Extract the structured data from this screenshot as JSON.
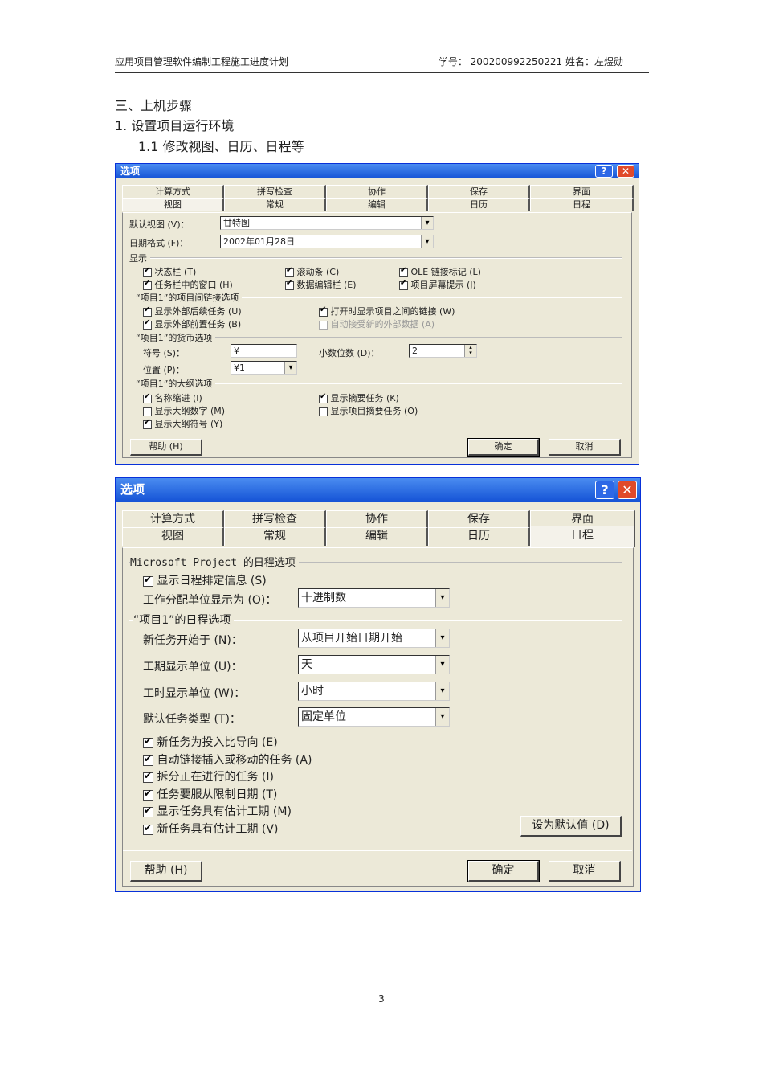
{
  "header": {
    "title": "应用项目管理软件编制工程施工进度计划",
    "student": "学号： 200200992250221    姓名：左煜勋"
  },
  "headings": {
    "h1": "三、上机步骤",
    "h2": "1.  设置项目运行环境",
    "h3": "1.1  修改视图、日历、日程等"
  },
  "dialog1": {
    "title": "选项",
    "help_icon": "question-icon",
    "close_icon": "close-icon",
    "tabs_row1": [
      "计算方式",
      "拼写检查",
      "协作",
      "保存",
      "界面"
    ],
    "tabs_row2": [
      "视图",
      "常规",
      "编辑",
      "日历",
      "日程"
    ],
    "active_tab": "视图",
    "default_view_label": "默认视图 (V)：",
    "default_view_value": "甘特图",
    "date_format_label": "日期格式 (F)：",
    "date_format_value": "2002年01月28日",
    "display_section": "显示",
    "display_checks": [
      {
        "label": "状态栏 (T)",
        "checked": true
      },
      {
        "label": "滚动条 (C)",
        "checked": true
      },
      {
        "label": "OLE 链接标记 (L)",
        "checked": true
      },
      {
        "label": "任务栏中的窗口 (H)",
        "checked": true
      },
      {
        "label": "数据编辑栏 (E)",
        "checked": true
      },
      {
        "label": "项目屏幕提示 (J)",
        "checked": true
      }
    ],
    "cross_section": "“项目1”的项目间链接选项",
    "cross_checks": [
      {
        "label": "显示外部后续任务 (U)",
        "checked": true
      },
      {
        "label": "打开时显示项目之间的链接 (W)",
        "checked": true
      },
      {
        "label": "显示外部前置任务 (B)",
        "checked": true
      },
      {
        "label": "自动接受新的外部数据 (A)",
        "checked": false,
        "disabled": true
      }
    ],
    "currency_section": "“项目1”的货币选项",
    "symbol_label": "符号 (S)：",
    "symbol_value": "¥",
    "decimals_label": "小数位数 (D)：",
    "decimals_value": "2",
    "position_label": "位置 (P)：",
    "position_value": "¥1",
    "outline_section": "“项目1”的大纲选项",
    "outline_checks": [
      {
        "label": "名称缩进 (I)",
        "checked": true
      },
      {
        "label": "显示摘要任务 (K)",
        "checked": true
      },
      {
        "label": "显示大纲数字 (M)",
        "checked": false
      },
      {
        "label": "显示项目摘要任务 (O)",
        "checked": false
      },
      {
        "label": "显示大纲符号 (Y)",
        "checked": true
      }
    ],
    "help_button": "帮助 (H)",
    "ok_button": "确定",
    "cancel_button": "取消"
  },
  "dialog2": {
    "title": "选项",
    "tabs_row1": [
      "计算方式",
      "拼写检查",
      "协作",
      "保存",
      "界面"
    ],
    "tabs_row2": [
      "视图",
      "常规",
      "编辑",
      "日历",
      "日程"
    ],
    "active_tab": "日程",
    "ms_section": "Microsoft Project 的日程选项",
    "show_sched_msgs": {
      "label": "显示日程排定信息 (S)",
      "checked": true
    },
    "assign_units_label": "工作分配单位显示为 (O)：",
    "assign_units_value": "十进制数",
    "proj_section": "“项目1”的日程选项",
    "new_tasks_label": "新任务开始于 (N)：",
    "new_tasks_value": "从项目开始日期开始",
    "duration_label": "工期显示单位 (U)：",
    "duration_value": "天",
    "work_label": "工时显示单位 (W)：",
    "work_value": "小时",
    "task_type_label": "默认任务类型 (T)：",
    "task_type_value": "固定单位",
    "checks": [
      {
        "label": "新任务为投入比导向 (E)",
        "checked": true
      },
      {
        "label": "自动链接插入或移动的任务 (A)",
        "checked": true
      },
      {
        "label": "拆分正在进行的任务 (I)",
        "checked": true
      },
      {
        "label": "任务要服从限制日期 (T)",
        "checked": true
      },
      {
        "label": "显示任务具有估计工期 (M)",
        "checked": true
      },
      {
        "label": "新任务具有估计工期 (V)",
        "checked": true
      }
    ],
    "set_default_button": "设为默认值 (D)",
    "help_button": "帮助 (H)",
    "ok_button": "确定",
    "cancel_button": "取消"
  },
  "page_number": "3"
}
